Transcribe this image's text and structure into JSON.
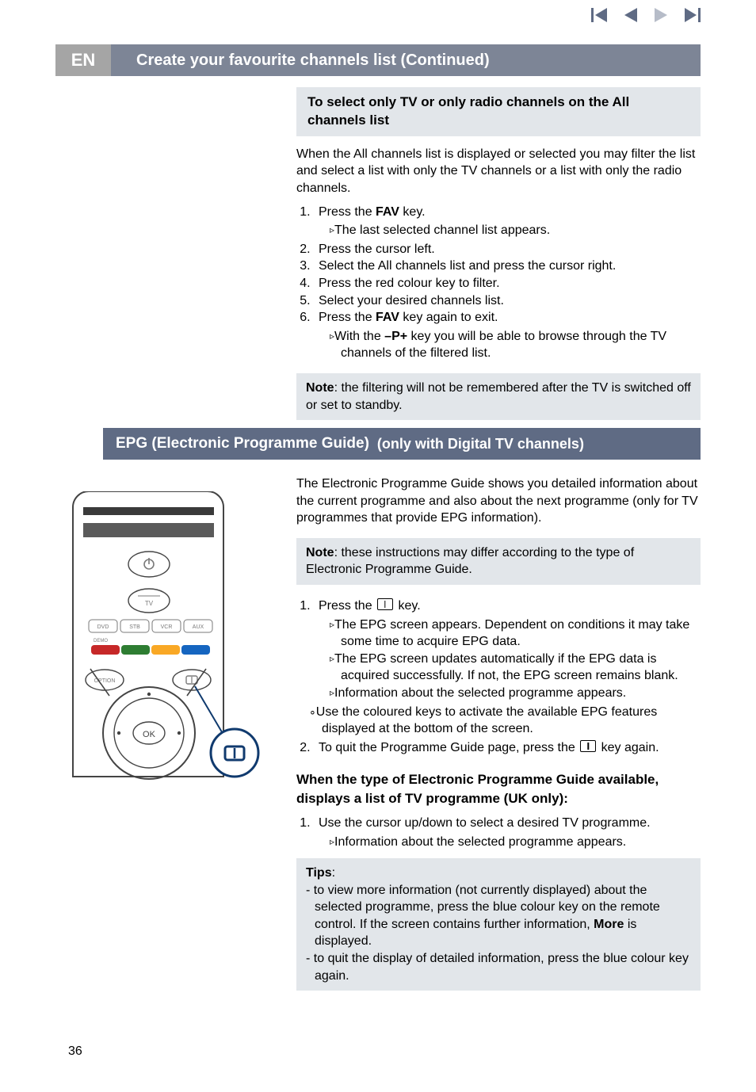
{
  "nav_icons": [
    "first-icon",
    "prev-icon",
    "next-icon",
    "last-icon"
  ],
  "lang": "EN",
  "header1": "Create your favourite channels list  (Continued)",
  "sec1": {
    "subtitle": "To select only TV or only radio channels on the All channels list",
    "intro": "When the All channels list is displayed or selected you may filter the list and select a list with only the TV channels or a list with only the radio channels.",
    "steps": {
      "s1": "Press the FAV key.",
      "s1_sub1": "The last selected channel list appears.",
      "s2": "Press the cursor left.",
      "s3": "Select the All channels list and press the cursor right.",
      "s4": "Press the red colour key to filter.",
      "s5": "Select your desired channels list.",
      "s6": "Press the FAV key again to exit.",
      "s6_sub1": "With the –P+ key you will be able to browse through the TV channels of the filtered list."
    },
    "note": "Note: the filtering will not be remembered after the TV is switched off or set to standby."
  },
  "header2_main": "EPG (Electronic Programme Guide)",
  "header2_sub": "(only with Digital TV channels)",
  "sec2": {
    "intro": "The Electronic Programme Guide shows you detailed information about the current programme and also about the next programme (only for TV programmes that provide EPG information).",
    "note1": "Note: these instructions may differ according to the type of Electronic Programme Guide.",
    "steps": {
      "s1_pre": "Press the",
      "s1_post": "key.",
      "s1_sub1": "The EPG screen appears. Dependent on conditions it may take some time to acquire EPG data.",
      "s1_sub2": "The EPG screen updates automatically if the EPG data is acquired successfully. If not, the EPG screen remains blank.",
      "s1_sub3": "Information about the selected programme appears.",
      "circ1": "Use the coloured keys to activate the available EPG features displayed at the bottom of the screen.",
      "s2_pre": "To quit the Programme Guide page, press the",
      "s2_post": "key again."
    },
    "bold_heading": "When the type of Electronic Programme Guide available, displays a list of TV programme (UK only):",
    "uk_s1": "Use the cursor up/down to select a desired TV programme.",
    "uk_s1_sub1": "Information about the selected programme appears.",
    "tips_title": "Tips",
    "tip1": "to view more information (not currently displayed) about the selected programme, press the blue colour key on the remote control. If the screen contains further information, More is displayed.",
    "tip2": "to quit the display of detailed information, press the blue colour key again."
  },
  "remote_labels": {
    "tv": "TV",
    "dvd": "DVD",
    "stb": "STB",
    "vcr": "VCR",
    "aux": "AUX",
    "demo": "DEMO",
    "option": "OPTION",
    "ok": "OK"
  },
  "page_number": "36"
}
